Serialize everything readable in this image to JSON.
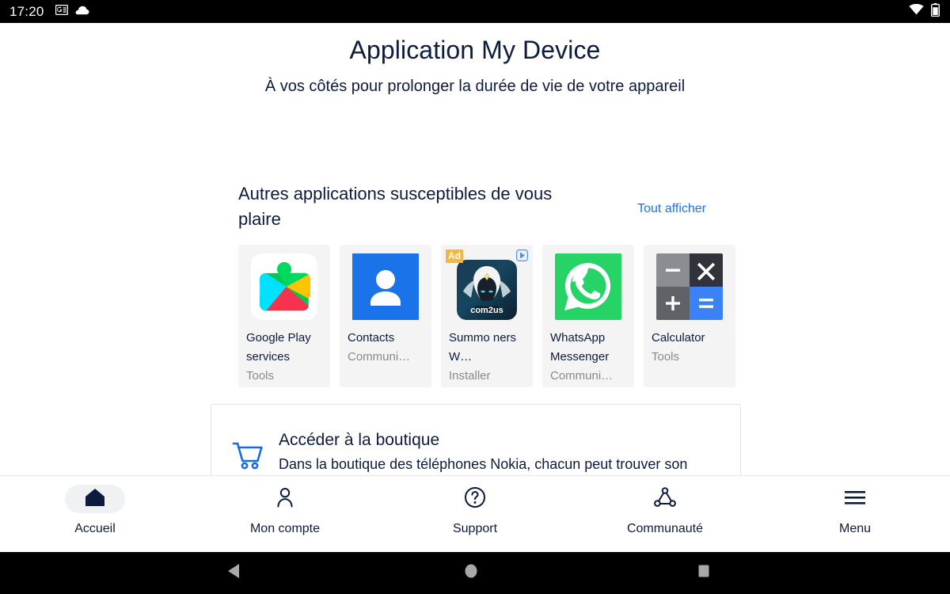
{
  "status_bar": {
    "clock": "17:20",
    "left_icons": [
      "google-news-icon",
      "cloud-icon"
    ],
    "right_icons": [
      "wifi-icon",
      "battery-icon"
    ]
  },
  "header": {
    "title": "Application My Device",
    "subtitle": "À vos côtés pour prolonger la durée de vie de votre appareil"
  },
  "apps_section": {
    "title": "Autres applications susceptibles de vous plaire",
    "link_label": "Tout afficher",
    "cards": [
      {
        "name": "Google Play services",
        "category": "Tools",
        "icon": "google-play-services-icon",
        "ad": false
      },
      {
        "name": "Contacts",
        "category": "Communi…",
        "icon": "contacts-icon",
        "ad": false
      },
      {
        "name": "Summo ners W…",
        "category": "Installer",
        "icon": "summoners-war-icon",
        "ad": true,
        "ad_label": "Ad"
      },
      {
        "name": "WhatsApp Messenger",
        "category": "Communi…",
        "icon": "whatsapp-icon",
        "ad": false
      },
      {
        "name": "Calculator",
        "category": "Tools",
        "icon": "calculator-icon",
        "ad": false
      }
    ]
  },
  "boutique": {
    "icon": "shopping-cart-icon",
    "title": "Accéder à la boutique",
    "description": "Dans la boutique des téléphones Nokia, chacun peut trouver son"
  },
  "bottom_nav": {
    "items": [
      {
        "label": "Accueil",
        "icon": "home-icon",
        "active": true
      },
      {
        "label": "Mon compte",
        "icon": "person-icon",
        "active": false
      },
      {
        "label": "Support",
        "icon": "help-circle-icon",
        "active": false
      },
      {
        "label": "Communauté",
        "icon": "share-nodes-icon",
        "active": false
      },
      {
        "label": "Menu",
        "icon": "hamburger-menu-icon",
        "active": false
      }
    ]
  },
  "system_nav": {
    "back": "back-triangle-icon",
    "home": "home-circle-icon",
    "recent": "recents-square-icon"
  },
  "colors": {
    "brand_navy": "#0d1b3e",
    "link_blue": "#1a73e8",
    "card_bg": "#f4f4f4",
    "ad_badge": "#f5b63c",
    "status_bg": "#000000"
  }
}
